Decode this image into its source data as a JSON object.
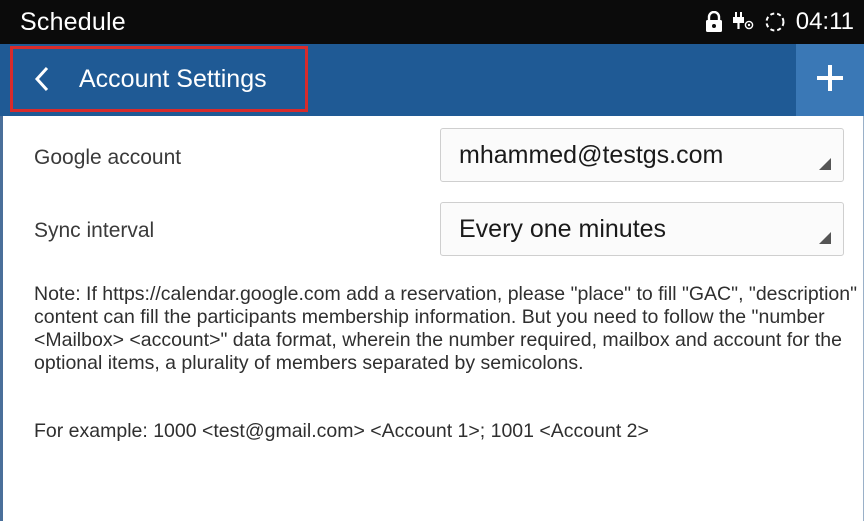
{
  "status_bar": {
    "app_title": "Schedule",
    "time": "04:11",
    "icons": [
      "lock-icon",
      "usb-icon",
      "sync-icon"
    ]
  },
  "app_bar": {
    "title": "Account Settings",
    "back_icon": "chevron-left-icon",
    "add_icon": "plus-icon"
  },
  "settings": {
    "google_account": {
      "label": "Google account",
      "value": "mhammed@testgs.com"
    },
    "sync_interval": {
      "label": "Sync interval",
      "value": "Every one minutes"
    }
  },
  "note": {
    "text": "Note: If https://calendar.google.com add a reservation, please \"place\" to fill \"GAC\", \"description\" content can fill the participants membership information. But you need to follow the \"number <Mailbox> <account>\" data format, wherein the number required, mailbox and account for the optional items, a plurality of members separated by semicolons.",
    "example": "For example: 1000 <test@gmail.com> <Account 1>; 1001 <Account 2>"
  },
  "colors": {
    "app_bar": "#1f5a95",
    "add_button": "#3a78b6",
    "highlight_box": "#d82b2b",
    "status_bar": "#0b0b0b"
  }
}
